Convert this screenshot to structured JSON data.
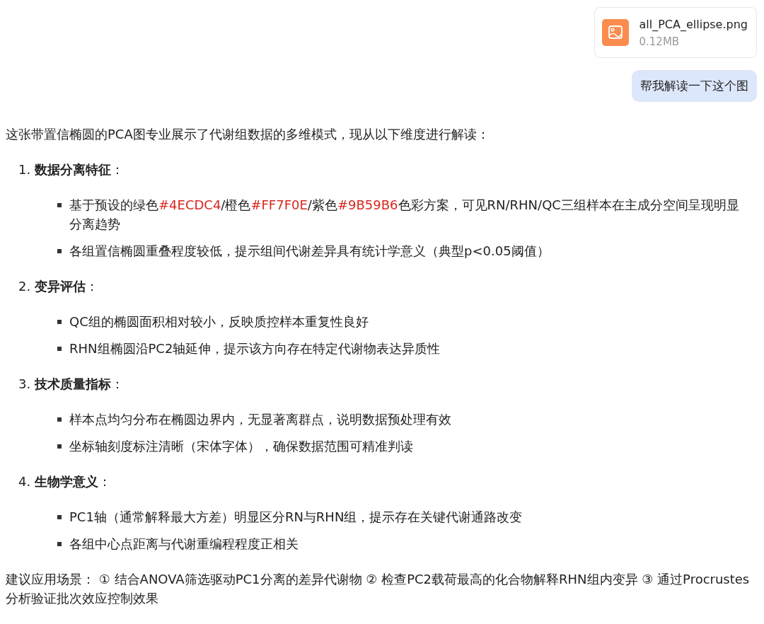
{
  "attachment": {
    "name": "all_PCA_ellipse.png",
    "size": "0.12MB"
  },
  "user_message": "帮我解读一下这个图",
  "answer": {
    "intro": "这张带置信椭圆的PCA图专业展示了代谢组数据的多维模式，现从以下维度进行解读：",
    "sections": [
      {
        "number": "1.",
        "title": "**数据分离特征**：",
        "bullets": [
          [
            {
              "text": "基于预设的绿色"
            },
            {
              "text": "#4ECDC4",
              "kind": "code"
            },
            {
              "text": "/橙色"
            },
            {
              "text": "#FF7F0E",
              "kind": "code"
            },
            {
              "text": "/紫色"
            },
            {
              "text": "#9B59B6",
              "kind": "code"
            },
            {
              "text": "色彩方案，可见RN/RHN/QC三组样本在主成分空间呈现明显分离趋势"
            }
          ],
          [
            {
              "text": "各组置信椭圆重叠程度较低，提示组间代谢差异具有统计学意义（典型p<0.05阈值）"
            }
          ]
        ]
      },
      {
        "number": "2.",
        "title": "**变异评估**：",
        "bullets": [
          [
            {
              "text": "QC组的椭圆面积相对较小，反映质控样本重复性良好"
            }
          ],
          [
            {
              "text": "RHN组椭圆沿PC2轴延伸，提示该方向存在特定代谢物表达异质性"
            }
          ]
        ]
      },
      {
        "number": "3.",
        "title": "**技术质量指标**：",
        "bullets": [
          [
            {
              "text": "样本点均匀分布在椭圆边界内，无显著离群点，说明数据预处理有效"
            }
          ],
          [
            {
              "text": "坐标轴刻度标注清晰（宋体字体），确保数据范围可精准判读"
            }
          ]
        ]
      },
      {
        "number": "4.",
        "title": "**生物学意义**：",
        "bullets": [
          [
            {
              "text": "PC1轴（通常解释最大方差）明显区分RN与RHN组，提示存在关键代谢通路改变"
            }
          ],
          [
            {
              "text": "各组中心点距离与代谢重编程程度正相关"
            }
          ]
        ]
      }
    ],
    "conclusion": "建议应用场景： ① 结合ANOVA筛选驱动PC1分离的差异代谢物 ② 检查PC2载荷最高的化合物解释RHN组内变异 ③ 通过Procrustes分析验证批次效应控制效果"
  }
}
